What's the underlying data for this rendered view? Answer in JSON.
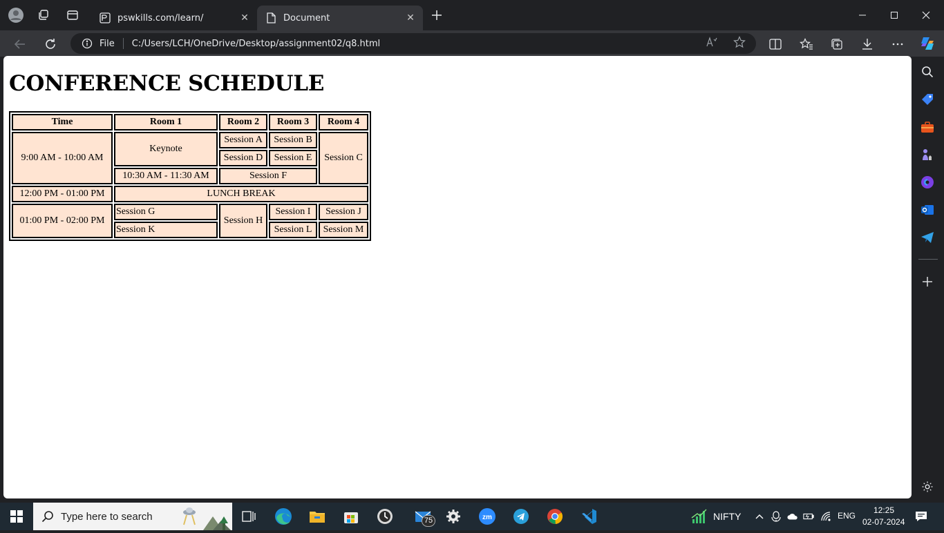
{
  "browser": {
    "tabs": [
      {
        "title": "pswkills.com/learn/",
        "active": false
      },
      {
        "title": "Document",
        "active": true
      }
    ],
    "address": {
      "scheme_label": "File",
      "url": "C:/Users/LCH/OneDrive/Desktop/assignment02/q8.html"
    }
  },
  "page": {
    "heading": "CONFERENCE SCHEDULE",
    "table": {
      "headers": [
        "Time",
        "Room 1",
        "Room 2",
        "Room 3",
        "Room 4"
      ],
      "cells": {
        "time1": "9:00 AM - 10:00 AM",
        "keynote": "Keynote",
        "session_a": "Session A",
        "session_b": "Session B",
        "session_c": "Session C",
        "session_d": "Session D",
        "session_e": "Session E",
        "time_1030": "10:30 AM - 11:30 AM",
        "session_f": "Session F",
        "time_lunch": "12:00 PM - 01:00 PM",
        "lunch": "LUNCH BREAK",
        "time3": "01:00 PM - 02:00 PM",
        "session_g": "Session G",
        "session_h": "Session H",
        "session_i": "Session I",
        "session_j": "Session J",
        "session_k": "Session K",
        "session_l": "Session L",
        "session_m": "Session M"
      },
      "cell_color": "#ffe4d2"
    }
  },
  "taskbar": {
    "search_placeholder": "Type here to search",
    "mail_badge": "75",
    "stock_label": "NIFTY",
    "language": "ENG",
    "time": "12:25",
    "date": "02-07-2024"
  }
}
